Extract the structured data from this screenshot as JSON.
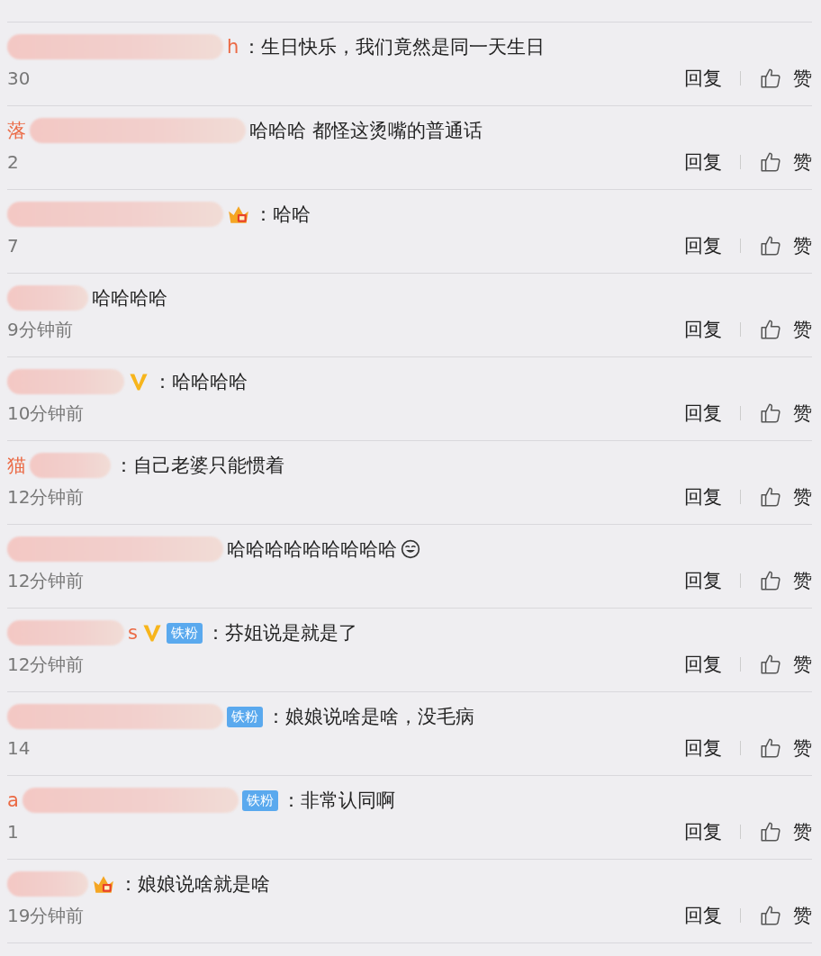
{
  "comments": [
    {
      "name_end": "h",
      "text": "：生日快乐，我们竟然是同一天生日",
      "time": "30",
      "reply": "回复",
      "like": "赞"
    },
    {
      "name_start": "落",
      "text": "哈哈哈  都怪这烫嘴的普通话",
      "time": "2",
      "reply": "回复",
      "like": "赞"
    },
    {
      "badges": [
        {
          "kind": "crown"
        }
      ],
      "text": "：哈哈",
      "time": "7",
      "reply": "回复",
      "like": "赞"
    },
    {
      "text": "哈哈哈哈",
      "time": "9分钟前",
      "reply": "回复",
      "like": "赞"
    },
    {
      "badges": [
        {
          "kind": "verified"
        }
      ],
      "text": "：哈哈哈哈",
      "time": "10分钟前",
      "reply": "回复",
      "like": "赞"
    },
    {
      "name_start": "猫",
      "text": "：自己老婆只能惯着",
      "time": "12分钟前",
      "reply": "回复",
      "like": "赞"
    },
    {
      "text": "哈哈哈哈哈哈哈哈哈",
      "emoji": {
        "kind": "smile"
      },
      "time": "12分钟前",
      "reply": "回复",
      "like": "赞"
    },
    {
      "name_end": "s",
      "badges": [
        {
          "kind": "verified"
        },
        {
          "kind": "fan",
          "label": "铁粉"
        }
      ],
      "text": "：芬姐说是就是了",
      "time": "12分钟前",
      "reply": "回复",
      "like": "赞"
    },
    {
      "badges": [
        {
          "kind": "fan",
          "label": "铁粉"
        }
      ],
      "text": "：娘娘说啥是啥，没毛病",
      "time": "14",
      "reply": "回复",
      "like": "赞"
    },
    {
      "name_start": "a",
      "badges": [
        {
          "kind": "fan",
          "label": "铁粉"
        }
      ],
      "text": "：非常认同啊",
      "time": "1",
      "reply": "回复",
      "like": "赞"
    },
    {
      "badges": [
        {
          "kind": "crown"
        }
      ],
      "text": "：娘娘说啥就是啥",
      "time": "19分钟前",
      "reply": "回复",
      "like": "赞"
    }
  ]
}
